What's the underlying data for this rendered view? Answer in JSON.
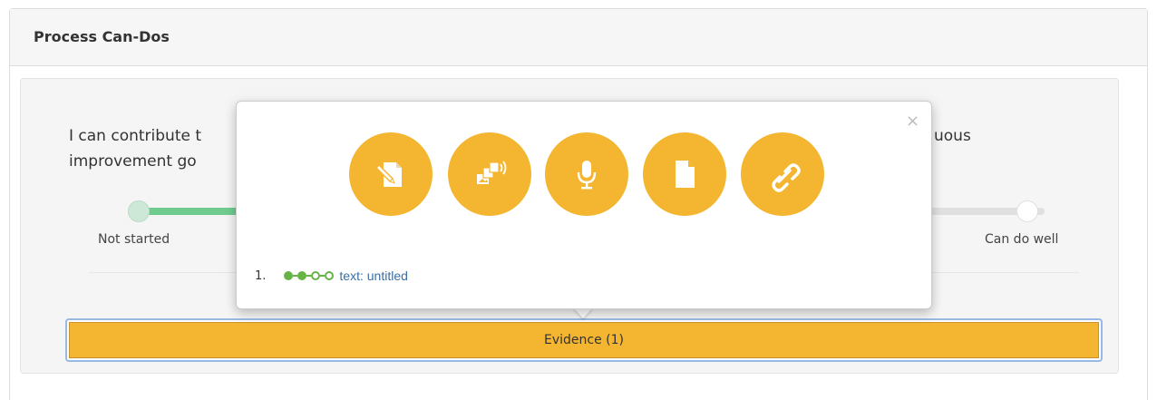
{
  "panel": {
    "title": "Process Can-Dos"
  },
  "cando": {
    "statement_start": "I can contribute t",
    "statement_line2": "improvement go",
    "statement_end": "uous",
    "scale_left": "Not started",
    "scale_right": "Can do well",
    "progress": 0.2
  },
  "evidence_button": {
    "label": "Evidence (1)"
  },
  "popover": {
    "close_label": "×",
    "icons": [
      {
        "name": "text-entry-icon"
      },
      {
        "name": "media-icon"
      },
      {
        "name": "audio-recording-icon"
      },
      {
        "name": "file-icon"
      },
      {
        "name": "link-icon"
      }
    ],
    "items": [
      {
        "number": "1.",
        "status_dots": [
          1,
          1,
          0,
          0
        ],
        "label": "text: untitled"
      }
    ]
  },
  "colors": {
    "accent": "#f4b630",
    "progress": "#6fcc8e",
    "status": "#65b446",
    "link": "#3a6ea5"
  }
}
